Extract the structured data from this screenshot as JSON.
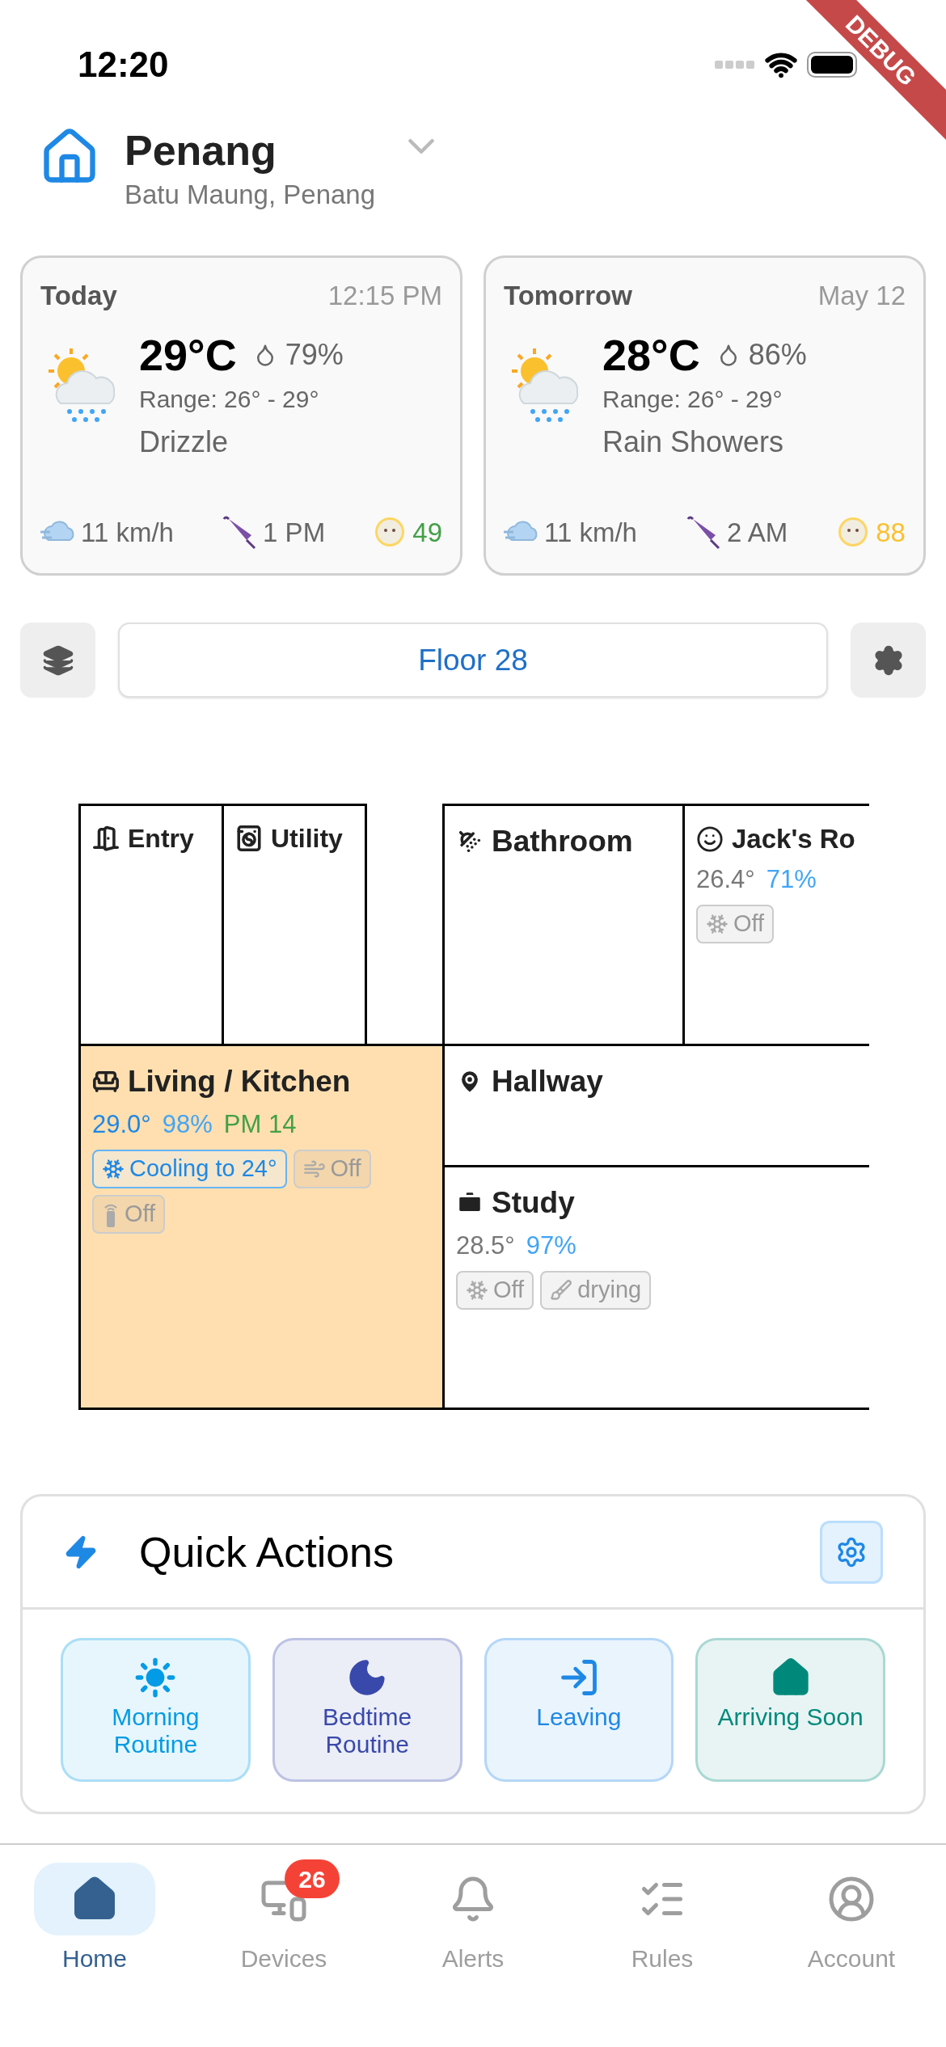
{
  "status_bar": {
    "time": "12:20"
  },
  "debug_banner": "DEBUG",
  "header": {
    "title": "Penang",
    "subtitle": "Batu Maung, Penang"
  },
  "weather": [
    {
      "label": "Today",
      "time": "12:15 PM",
      "temp": "29°C",
      "humidity": "79%",
      "range": "Range: 26° - 29°",
      "condition": "Drizzle",
      "wind": "11 km/h",
      "rain_time": "1 PM",
      "aqi": "49",
      "color": "#43a047"
    },
    {
      "label": "Tomorrow",
      "time": "May 12",
      "temp": "28°C",
      "humidity": "86%",
      "range": "Range: 26° - 29°",
      "condition": "Rain Showers",
      "wind": "11 km/h",
      "rain_time": "2 AM",
      "aqi": "88",
      "color": "#fbc02d"
    }
  ],
  "floor": {
    "label": "Floor 28"
  },
  "rooms": [
    {
      "name": "Entry",
      "selected": false
    },
    {
      "name": "Utility",
      "selected": false
    },
    {
      "name": "Bathroom",
      "selected": false
    },
    {
      "name": "Jack's Ro",
      "selected": false,
      "temp": "26.4°",
      "humidity": "71%",
      "chips": [
        {
          "kind": "ac",
          "label": "Off",
          "on": false
        }
      ]
    },
    {
      "name": "Living / Kitchen",
      "selected": true,
      "temp": "29.0°",
      "humidity": "98%",
      "pm": "PM 14",
      "chips": [
        {
          "kind": "ac",
          "label": "Cooling to 24°",
          "on": true
        },
        {
          "kind": "fan",
          "label": "Off",
          "on": false
        },
        {
          "kind": "remote",
          "label": "Off",
          "on": false
        }
      ]
    },
    {
      "name": "Hallway",
      "selected": false
    },
    {
      "name": "Study",
      "selected": false,
      "temp": "28.5°",
      "humidity": "97%",
      "chips": [
        {
          "kind": "ac",
          "label": "Off",
          "on": false
        },
        {
          "kind": "dryer",
          "label": "drying",
          "on": false
        }
      ]
    }
  ],
  "quick_actions": {
    "title": "Quick Actions",
    "items": [
      {
        "kind": "sun",
        "label": "Morning Routine",
        "color": "#039be5"
      },
      {
        "kind": "moon",
        "label": "Bedtime Routine",
        "color": "#3949ab"
      },
      {
        "kind": "leave",
        "label": "Leaving",
        "color": "#1e88e5"
      },
      {
        "kind": "home",
        "label": "Arriving Soon",
        "color": "#00897b"
      }
    ]
  },
  "nav": [
    {
      "kind": "home",
      "label": "Home",
      "selected": true
    },
    {
      "kind": "devices",
      "label": "Devices",
      "selected": false,
      "badge": "26"
    },
    {
      "kind": "alerts",
      "label": "Alerts",
      "selected": false
    },
    {
      "kind": "rules",
      "label": "Rules",
      "selected": false
    },
    {
      "kind": "account",
      "label": "Account",
      "selected": false
    }
  ]
}
